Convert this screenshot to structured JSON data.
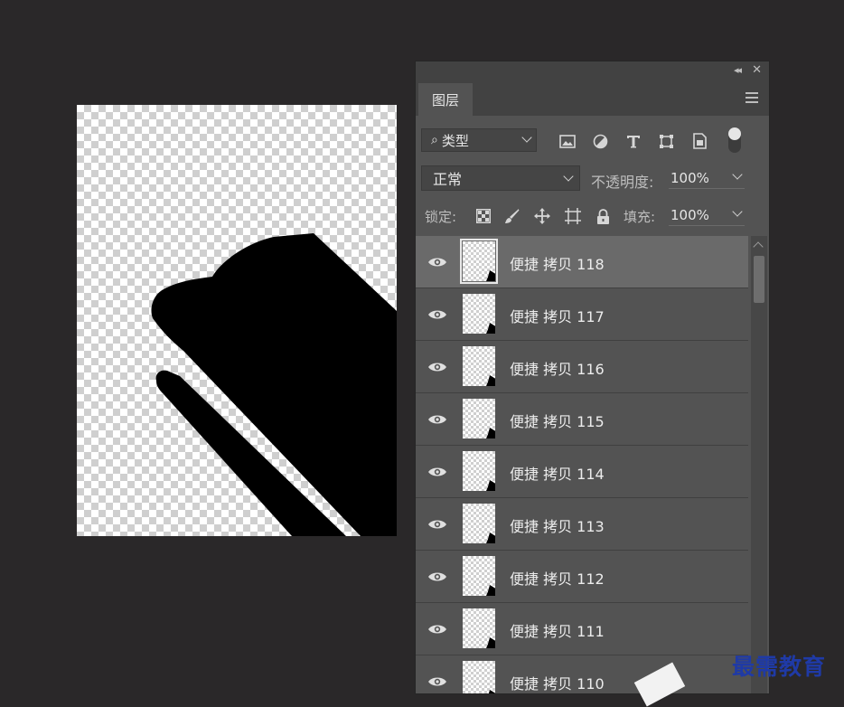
{
  "panel": {
    "tab_label": "图层",
    "filter": {
      "label": "类型",
      "icon": "search-icon"
    },
    "filter_icons": [
      "image-filter-icon",
      "adjustment-filter-icon",
      "text-filter-icon",
      "shape-filter-icon",
      "smart-object-filter-icon"
    ],
    "blend_mode": "正常",
    "opacity_label": "不透明度:",
    "opacity_value": "100%",
    "lock_label": "锁定:",
    "lock_icons": [
      "lock-transparent-pixels-icon",
      "lock-image-pixels-icon",
      "lock-position-icon",
      "lock-artboard-icon",
      "lock-all-icon"
    ],
    "fill_label": "填充:",
    "fill_value": "100%"
  },
  "layers": [
    {
      "name": "便捷 拷贝 118",
      "selected": true
    },
    {
      "name": "便捷 拷贝 117",
      "selected": false
    },
    {
      "name": "便捷 拷贝 116",
      "selected": false
    },
    {
      "name": "便捷 拷贝 115",
      "selected": false
    },
    {
      "name": "便捷 拷贝 114",
      "selected": false
    },
    {
      "name": "便捷 拷贝 113",
      "selected": false
    },
    {
      "name": "便捷 拷贝 112",
      "selected": false
    },
    {
      "name": "便捷 拷贝 111",
      "selected": false
    },
    {
      "name": "便捷 拷贝 110",
      "selected": false
    }
  ],
  "watermark": "最需教育",
  "colors": {
    "workspace_bg": "#2a2829",
    "panel_bg": "#535353",
    "selected_row_bg": "#6a6a6a",
    "watermark": "#1f3aa6"
  }
}
